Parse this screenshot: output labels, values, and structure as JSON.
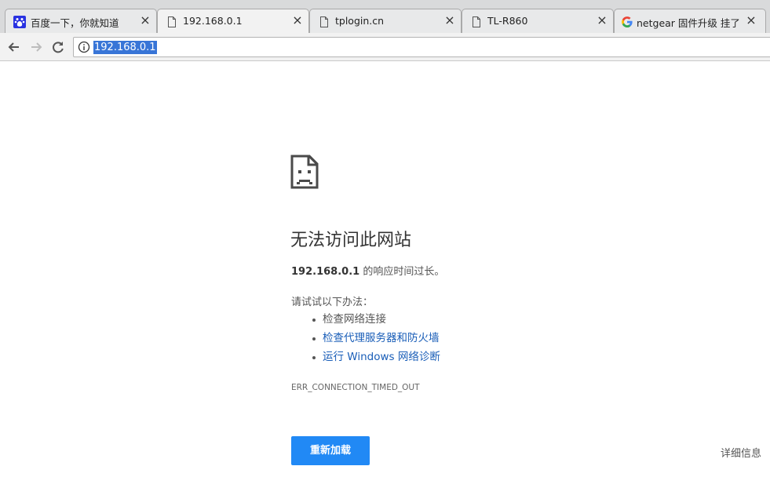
{
  "tabs": [
    {
      "title": "百度一下，你就知道",
      "icon": "baidu-paw-icon",
      "active": false
    },
    {
      "title": "192.168.0.1",
      "icon": "page-icon",
      "active": true
    },
    {
      "title": "tplogin.cn",
      "icon": "page-icon",
      "active": false
    },
    {
      "title": "TL-R860",
      "icon": "page-icon",
      "active": false
    },
    {
      "title": "netgear 固件升级 挂了 -",
      "icon": "google-g-icon",
      "active": false
    }
  ],
  "toolbar": {
    "url": "192.168.0.1",
    "back_icon": "arrow-left-icon",
    "forward_icon": "arrow-right-icon",
    "reload_icon": "reload-icon",
    "info_icon": "info-icon"
  },
  "error": {
    "icon": "sad-page-icon",
    "heading": "无法访问此网站",
    "host": "192.168.0.1",
    "summary_suffix": " 的响应时间过长。",
    "suggest_title": "请试试以下办法：",
    "suggestions": [
      {
        "text": "检查网络连接",
        "link": false
      },
      {
        "text": "检查代理服务器和防火墙",
        "link": true
      },
      {
        "text": "运行 Windows 网络诊断",
        "link": true
      }
    ],
    "code": "ERR_CONNECTION_TIMED_OUT",
    "reload_label": "重新加载",
    "details_label": "详细信息"
  },
  "colors": {
    "accent": "#2189f5",
    "link": "#1a5eb8",
    "url_highlight": "#3875d7"
  }
}
